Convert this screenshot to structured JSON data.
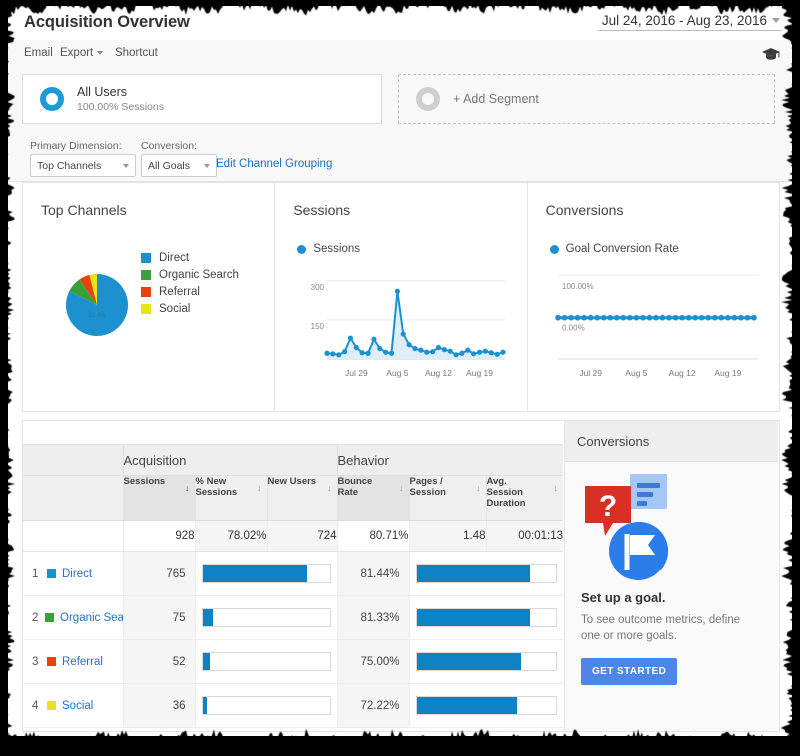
{
  "header": {
    "title": "Acquisition Overview",
    "date_range": "Jul 24, 2016 - Aug 23, 2016",
    "date_caret_icon": "chevron-down-icon",
    "academy_icon": "graduation-cap-icon"
  },
  "toolbar": {
    "email": "Email",
    "export": "Export",
    "export_caret_icon": "chevron-down-icon",
    "shortcut": "Shortcut"
  },
  "segments": {
    "all_users": {
      "name": "All Users",
      "sub": "100.00% Sessions",
      "icon": "donut-icon"
    },
    "add_segment": {
      "label": "+ Add Segment",
      "icon": "donut-outline-icon"
    }
  },
  "dimension_row": {
    "primary_label": "Primary Dimension:",
    "primary_value": "Top Channels",
    "conversion_label": "Conversion:",
    "conversion_value": "All Goals",
    "edit_link": "Edit Channel Grouping"
  },
  "panels": {
    "top_channels": {
      "title": "Top Channels"
    },
    "sessions": {
      "title": "Sessions"
    },
    "conversions": {
      "title": "Conversions"
    }
  },
  "table": {
    "groups": {
      "acquisition": "Acquisition",
      "behavior": "Behavior"
    },
    "columns": [
      {
        "label": "Sessions",
        "sorted": true
      },
      {
        "label": "% New\nSessions",
        "sorted": false
      },
      {
        "label": "New Users",
        "sorted": false
      },
      {
        "label": "Bounce\nRate",
        "sorted": false
      },
      {
        "label": "Pages /\nSession",
        "sorted": false
      },
      {
        "label": "Avg.\nSession\nDuration",
        "sorted": false
      }
    ],
    "col_labels": {
      "sessions": "Sessions",
      "new_sessions_l1": "% New",
      "new_sessions_l2": "Sessions",
      "new_users": "New Users",
      "bounce_l1": "Bounce",
      "bounce_l2": "Rate",
      "pages_l1": "Pages /",
      "pages_l2": "Session",
      "avg_l1": "Avg.",
      "avg_l2": "Session",
      "avg_l3": "Duration"
    },
    "totals": {
      "sessions": "928",
      "pct_new_sessions": "78.02%",
      "new_users": "724",
      "bounce_rate": "80.71%",
      "pages_session": "1.48",
      "avg_duration": "00:01:13"
    },
    "rows": [
      {
        "index": "1",
        "channel": "Direct",
        "color": "#1d91d0",
        "sessions": "765",
        "sessions_pct": 82.4,
        "bounce_rate": "81.44%",
        "bounce_pct": 81.44
      },
      {
        "index": "2",
        "channel": "Organic Search",
        "color": "#3aa13a",
        "sessions": "75",
        "sessions_pct": 8.1,
        "bounce_rate": "81.33%",
        "bounce_pct": 81.33
      },
      {
        "index": "3",
        "channel": "Referral",
        "color": "#e8430c",
        "sessions": "52",
        "sessions_pct": 5.6,
        "bounce_rate": "75.00%",
        "bounce_pct": 75.0
      },
      {
        "index": "4",
        "channel": "Social",
        "color": "#e9e512",
        "sessions": "36",
        "sessions_pct": 3.9,
        "bounce_rate": "72.22%",
        "bounce_pct": 72.22
      }
    ]
  },
  "conversions_aside": {
    "title": "Conversions",
    "heading": "Set up a goal.",
    "body": "To see outcome metrics, define one or more goals.",
    "button": "GET STARTED",
    "art_icon": "goal-flag-icon"
  },
  "chart_data": [
    {
      "type": "pie",
      "title": "Top Channels",
      "labels": [
        "Direct",
        "Organic Search",
        "Referral",
        "Social"
      ],
      "values": [
        82.4,
        8.1,
        5.6,
        3.9
      ],
      "colors": [
        "#1d91d0",
        "#3aa13a",
        "#e8430c",
        "#e9e512"
      ],
      "data_label": "82.4%",
      "legend_position": "right"
    },
    {
      "type": "line",
      "title": "Sessions",
      "legend": [
        "Sessions"
      ],
      "series_color": "#1d91d0",
      "ylabel": "",
      "xlabel": "",
      "ylim": [
        0,
        330
      ],
      "yticks": [
        150,
        300
      ],
      "ytick_labels": [
        "150",
        "300"
      ],
      "xtick_labels": [
        "Jul 29",
        "Aug 5",
        "Aug 12",
        "Aug 19"
      ],
      "xtick_positions": [
        5,
        12,
        19,
        26
      ],
      "x": [
        "Jul 24",
        "Jul 25",
        "Jul 26",
        "Jul 27",
        "Jul 28",
        "Jul 29",
        "Jul 30",
        "Jul 31",
        "Aug 1",
        "Aug 2",
        "Aug 3",
        "Aug 4",
        "Aug 5",
        "Aug 6",
        "Aug 7",
        "Aug 8",
        "Aug 9",
        "Aug 10",
        "Aug 11",
        "Aug 12",
        "Aug 13",
        "Aug 14",
        "Aug 15",
        "Aug 16",
        "Aug 17",
        "Aug 18",
        "Aug 19",
        "Aug 20",
        "Aug 21",
        "Aug 22",
        "Aug 23"
      ],
      "values": [
        22,
        20,
        16,
        28,
        80,
        44,
        24,
        22,
        76,
        40,
        26,
        22,
        260,
        96,
        55,
        40,
        34,
        26,
        28,
        44,
        36,
        30,
        16,
        22,
        34,
        20,
        26,
        30,
        24,
        18,
        26
      ],
      "grid": true
    },
    {
      "type": "line",
      "title": "Conversions",
      "legend": [
        "Goal Conversion Rate"
      ],
      "series_color": "#1d91d0",
      "ylim": [
        0,
        100
      ],
      "ytick_labels": [
        "0.00%",
        "100.00%"
      ],
      "xtick_labels": [
        "Jul 29",
        "Aug 5",
        "Aug 12",
        "Aug 19"
      ],
      "x": [
        "Jul 24",
        "Jul 25",
        "Jul 26",
        "Jul 27",
        "Jul 28",
        "Jul 29",
        "Jul 30",
        "Jul 31",
        "Aug 1",
        "Aug 2",
        "Aug 3",
        "Aug 4",
        "Aug 5",
        "Aug 6",
        "Aug 7",
        "Aug 8",
        "Aug 9",
        "Aug 10",
        "Aug 11",
        "Aug 12",
        "Aug 13",
        "Aug 14",
        "Aug 15",
        "Aug 16",
        "Aug 17",
        "Aug 18",
        "Aug 19",
        "Aug 20",
        "Aug 21",
        "Aug 22",
        "Aug 23"
      ],
      "values": [
        0,
        0,
        0,
        0,
        0,
        0,
        0,
        0,
        0,
        0,
        0,
        0,
        0,
        0,
        0,
        0,
        0,
        0,
        0,
        0,
        0,
        0,
        0,
        0,
        0,
        0,
        0,
        0,
        0,
        0,
        0
      ],
      "grid": true
    }
  ],
  "colors": {
    "accent_blue": "#1d91d0",
    "link_blue": "#2a6fc4",
    "bar_blue": "#0e82c4",
    "button_blue": "#4d86e8"
  }
}
